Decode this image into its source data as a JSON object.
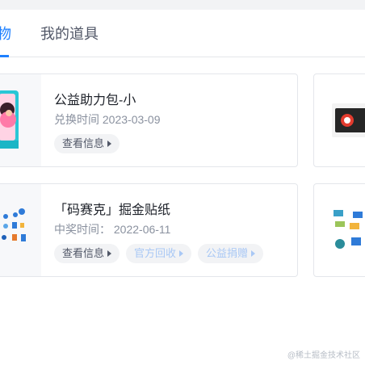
{
  "tabs": {
    "active_label": "物",
    "other_label": "我的道具"
  },
  "items": [
    {
      "title": "公益助力包-小",
      "meta_label": "兑换时间",
      "meta_value": "2023-03-09",
      "buttons": [
        "查看信息"
      ]
    },
    {
      "title": "「码赛克」掘金贴纸",
      "meta_label": "中奖时间：",
      "meta_value": "2022-06-11",
      "buttons": [
        "查看信息",
        "官方回收",
        "公益捐赠"
      ]
    }
  ],
  "watermark": "@稀土掘金技术社区",
  "colors": {
    "accent": "#1e80ff",
    "card_border": "#e4e6eb",
    "meta_text": "#8a919f",
    "disabled_button_text": "#a9c8f5"
  }
}
